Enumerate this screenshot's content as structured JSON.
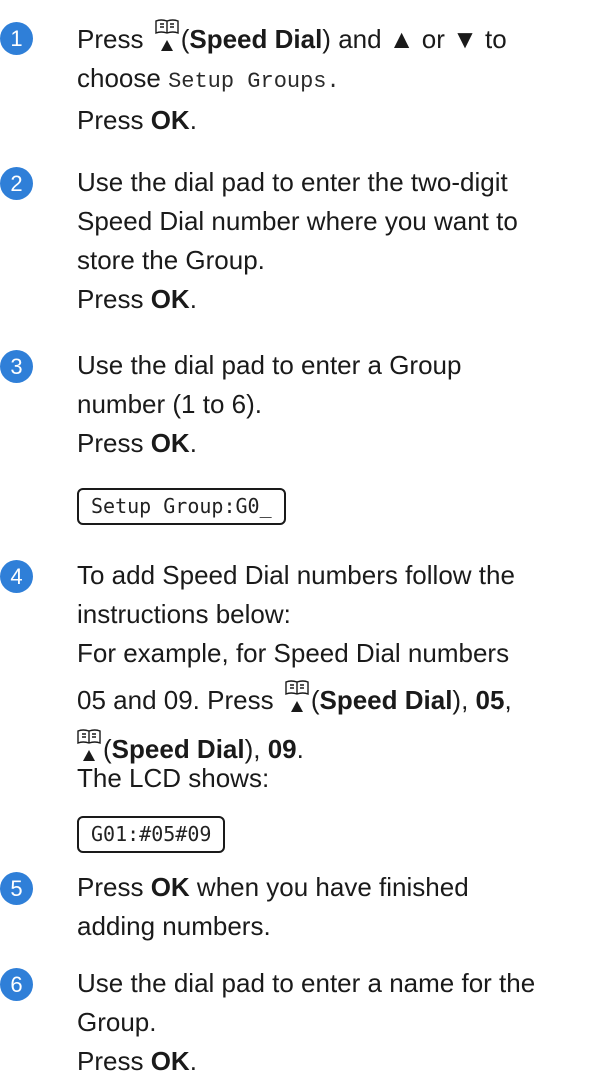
{
  "steps": [
    {
      "number": "1",
      "p1_pre": "Press ",
      "p1_bold": "Speed Dial",
      "p1_post": " and ▲ or ▼ to",
      "p2_pre": "choose ",
      "p2_mono": "Setup Groups.",
      "p3_pre": "Press ",
      "p3_bold": "OK",
      "p3_post": "."
    },
    {
      "number": "2",
      "l1": "Use the dial pad to enter the two-digit",
      "l2": "Speed Dial number where you want to",
      "l3": "store the Group.",
      "l4_pre": "Press ",
      "l4_bold": "OK",
      "l4_post": "."
    },
    {
      "number": "3",
      "l1": "Use the dial pad to enter a Group",
      "l2": "number (1 to 6).",
      "l3_pre": "Press ",
      "l3_bold": "OK",
      "l3_post": ".",
      "lcd": "Setup Group:G0_"
    },
    {
      "number": "4",
      "l1": "To add Speed Dial numbers follow the",
      "l2": "instructions below:",
      "l3": "For example, for Speed Dial numbers",
      "l4_pre": "05 and 09. Press ",
      "l4_bold1": "Speed Dial",
      "l4_mid": "), ",
      "l4_bold2": "05",
      "l4_post": ",",
      "l5_bold1": "Speed Dial",
      "l5_mid": "), ",
      "l5_bold2": "09",
      "l5_post": ".",
      "l6": "The LCD shows:",
      "lcd": "G01:#05#09"
    },
    {
      "number": "5",
      "l1_pre": "Press ",
      "l1_bold": "OK",
      "l1_post": " when you have finished",
      "l2": "adding numbers."
    },
    {
      "number": "6",
      "l1": "Use the dial pad to enter a name for the",
      "l2": "Group.",
      "l3_pre": "Press ",
      "l3_bold": "OK",
      "l3_post": "."
    }
  ],
  "icons": {
    "speed_dial": "speed-dial-book-icon"
  },
  "colors": {
    "step_circle": "#2f7fd8",
    "text": "#1a1a1a"
  }
}
